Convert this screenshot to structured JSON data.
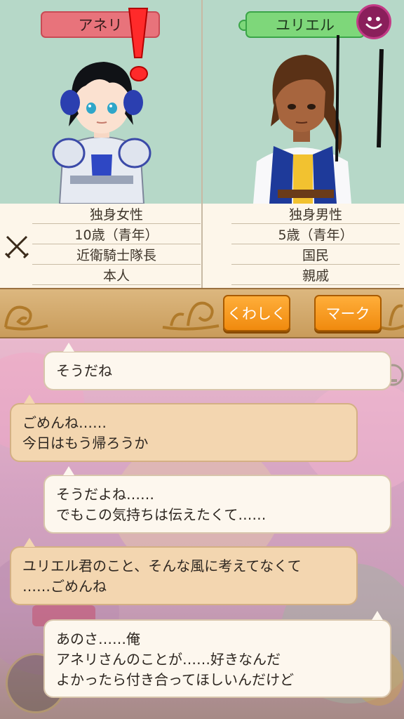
{
  "left_character": {
    "name": "アネリ",
    "rows": [
      "独身女性",
      "10歳（青年）",
      "近衛騎士隊長",
      "本人"
    ]
  },
  "right_character": {
    "name": "ユリエル",
    "rows": [
      "独身男性",
      "5歳（青年）",
      "国民",
      "親戚"
    ]
  },
  "buttons": {
    "detail": "くわしく",
    "mark": "マーク"
  },
  "messages": [
    {
      "speaker": "right",
      "lines": [
        "そうだね"
      ]
    },
    {
      "speaker": "left",
      "lines": [
        "ごめんね……",
        "今日はもう帰ろうか"
      ]
    },
    {
      "speaker": "right",
      "lines": [
        "そうだよね……",
        "でもこの気持ちは伝えたくて……"
      ]
    },
    {
      "speaker": "left",
      "lines": [
        "ユリエル君のこと、そんな風に考えてなくて",
        "……ごめんね"
      ]
    },
    {
      "speaker": "right",
      "lines": [
        "あのさ……俺",
        "アネリさんのことが……好きなんだ",
        "よかったら付き合ってほしいんだけど"
      ]
    }
  ],
  "colors": {
    "left_tag": "#e8737b",
    "right_tag": "#7ed77a",
    "button_orange": "#f5961e"
  },
  "icons": [
    "exclamation-icon",
    "smile-icon",
    "crossed-swords-icon",
    "hold-hand-icon"
  ]
}
